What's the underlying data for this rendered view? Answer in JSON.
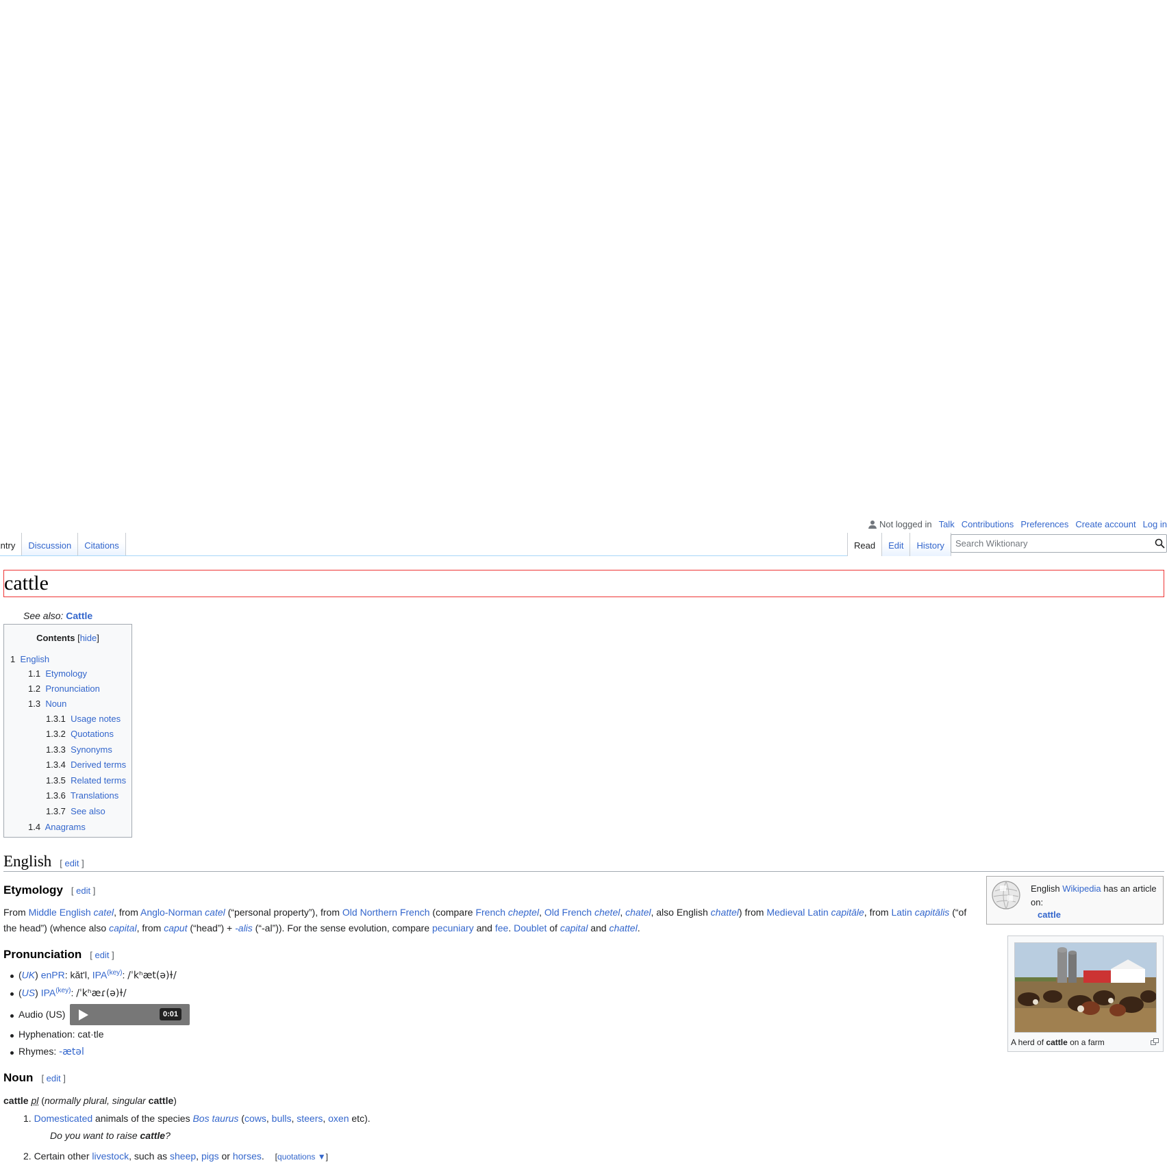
{
  "personal": {
    "not_logged_in": "Not logged in",
    "talk": "Talk",
    "contributions": "Contributions",
    "preferences": "Preferences",
    "create_account": "Create account",
    "log_in": "Log in"
  },
  "tabs_left": [
    "Entry",
    "Discussion",
    "Citations"
  ],
  "tabs_right": [
    "Read",
    "Edit",
    "History"
  ],
  "search": {
    "placeholder": "Search Wiktionary"
  },
  "page_title": "cattle",
  "see_also": {
    "label": "See also:",
    "link": "Cattle"
  },
  "toc": {
    "title": "Contents",
    "hide": "hide",
    "items": [
      {
        "num": "1",
        "label": "English"
      },
      {
        "num": "1.1",
        "label": "Etymology"
      },
      {
        "num": "1.2",
        "label": "Pronunciation"
      },
      {
        "num": "1.3",
        "label": "Noun"
      },
      {
        "num": "1.3.1",
        "label": "Usage notes"
      },
      {
        "num": "1.3.2",
        "label": "Quotations"
      },
      {
        "num": "1.3.3",
        "label": "Synonyms"
      },
      {
        "num": "1.3.4",
        "label": "Derived terms"
      },
      {
        "num": "1.3.5",
        "label": "Related terms"
      },
      {
        "num": "1.3.6",
        "label": "Translations"
      },
      {
        "num": "1.3.7",
        "label": "See also"
      },
      {
        "num": "1.4",
        "label": "Anagrams"
      }
    ]
  },
  "edit_label": "edit",
  "english": {
    "heading": "English"
  },
  "etymology": {
    "heading": "Etymology"
  },
  "sister": {
    "prefix": "English",
    "link": "Wikipedia",
    "suffix": "has an article on:",
    "article": "cattle"
  },
  "thumb": {
    "caption_pre": "A herd of",
    "caption_bold": "cattle",
    "caption_post": "on a farm"
  },
  "pronunciation": {
    "heading": "Pronunciation",
    "uk_label": "UK",
    "enpr": "enPR",
    "enpr_value": "kăt'l",
    "ipa": "IPA",
    "key": "(key)",
    "uk_ipa": "/ˈkʰæt(ə)ɫ/",
    "us_label": "US",
    "us_ipa": "/ˈkʰæɾ(ə)ɫ/",
    "audio_label": "Audio (US)",
    "audio_time": "0:01",
    "hyphenation": "Hyphenation: cat·tle",
    "rhymes_label": "Rhymes:",
    "rhymes_value": "-ætəl"
  },
  "noun": {
    "heading": "Noun",
    "headword": "cattle",
    "pl": "pl",
    "normally": "normally plural, singular",
    "singular": "cattle",
    "sense1_example_pre": "Do you want to raise",
    "sense1_example_bold": "cattle",
    "sense1_example_post": "?",
    "quotations": "quotations ▼"
  }
}
